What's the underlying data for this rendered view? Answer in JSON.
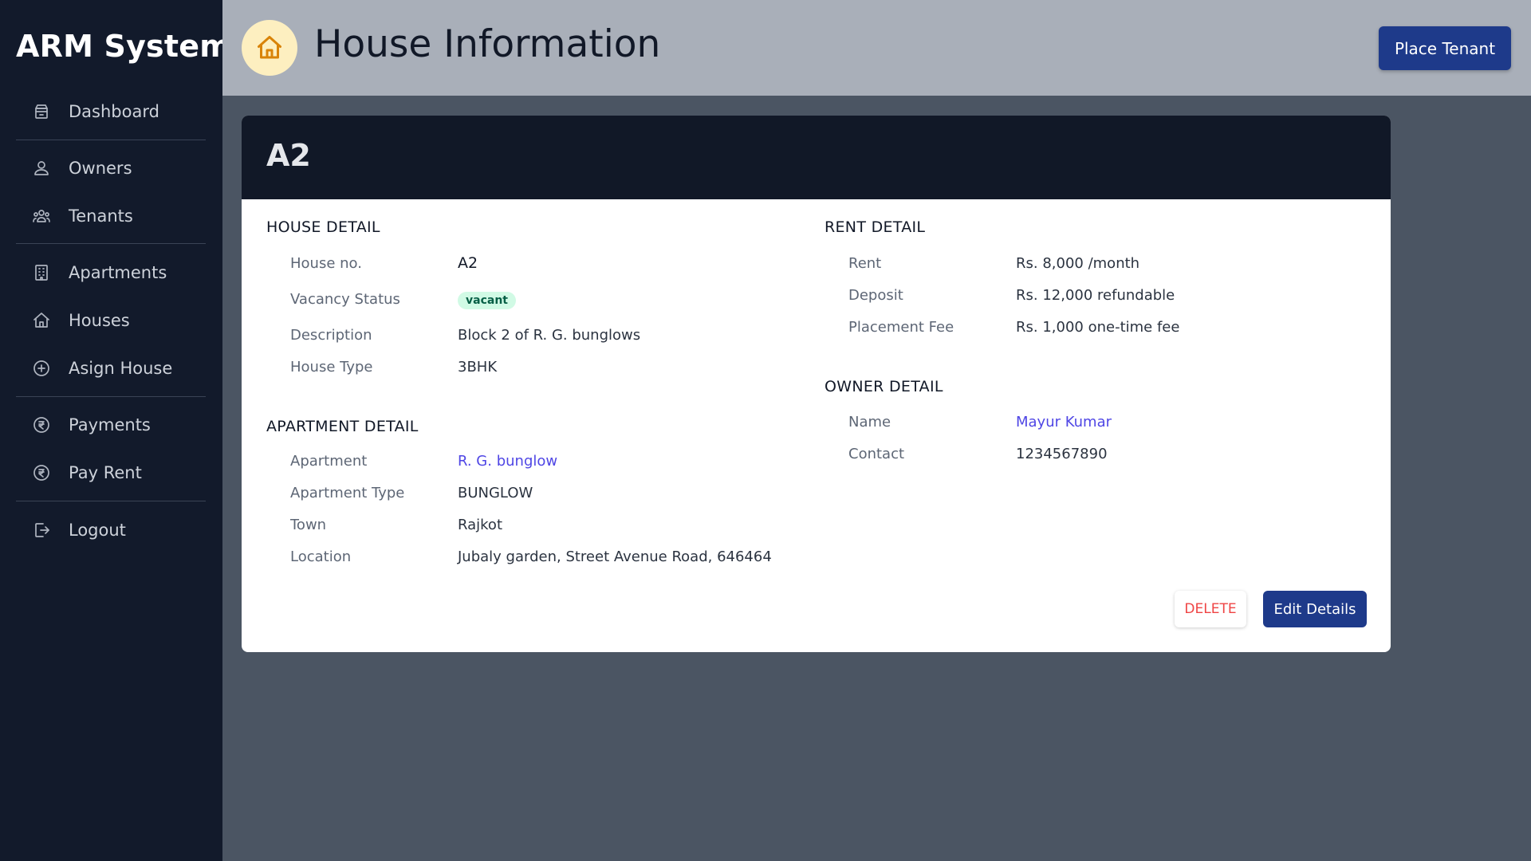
{
  "app": {
    "title": "ARM System"
  },
  "sidebar": {
    "items": [
      {
        "label": "Dashboard",
        "icon": "archive-icon"
      },
      {
        "label": "Owners",
        "icon": "users-icon"
      },
      {
        "label": "Tenants",
        "icon": "user-group-icon"
      },
      {
        "label": "Apartments",
        "icon": "building-icon"
      },
      {
        "label": "Houses",
        "icon": "home-icon"
      },
      {
        "label": "Asign House",
        "icon": "plus-circle-icon"
      },
      {
        "label": "Payments",
        "icon": "rupee-circle-icon"
      },
      {
        "label": "Pay Rent",
        "icon": "rupee-circle-icon"
      },
      {
        "label": "Logout",
        "icon": "logout-icon"
      }
    ]
  },
  "header": {
    "title": "House Information",
    "icon": "home-icon",
    "place_tenant_label": "Place Tenant"
  },
  "card": {
    "title": "A2",
    "house_detail": {
      "heading": "HOUSE DETAIL",
      "house_no_label": "House no.",
      "house_no": "A2",
      "vacancy_label": "Vacancy Status",
      "vacancy": "vacant",
      "description_label": "Description",
      "description": "Block 2 of R. G. bunglows",
      "type_label": "House Type",
      "type": "3BHK"
    },
    "apartment_detail": {
      "heading": "APARTMENT DETAIL",
      "apartment_label": "Apartment",
      "apartment": "R. G. bunglow",
      "type_label": "Apartment Type",
      "type": "BUNGLOW",
      "town_label": "Town",
      "town": "Rajkot",
      "location_label": "Location",
      "location": "Jubaly garden, Street Avenue Road, 646464"
    },
    "rent_detail": {
      "heading": "RENT DETAIL",
      "rent_label": "Rent",
      "rent": "Rs. 8,000 /month",
      "deposit_label": "Deposit",
      "deposit": "Rs. 12,000 refundable",
      "placement_label": "Placement Fee",
      "placement": "Rs. 1,000 one-time fee"
    },
    "owner_detail": {
      "heading": "OWNER DETAIL",
      "name_label": "Name",
      "name": "Mayur Kumar",
      "contact_label": "Contact",
      "contact": "1234567890"
    },
    "delete_label": "DELETE",
    "edit_label": "Edit Details"
  },
  "colors": {
    "sidebar_bg": "#121a2b",
    "header_bg": "#a9afb9",
    "accent": "#1e3a8a",
    "link": "#4f46e5",
    "danger": "#ef4444",
    "badge_bg": "#d1fae5"
  }
}
